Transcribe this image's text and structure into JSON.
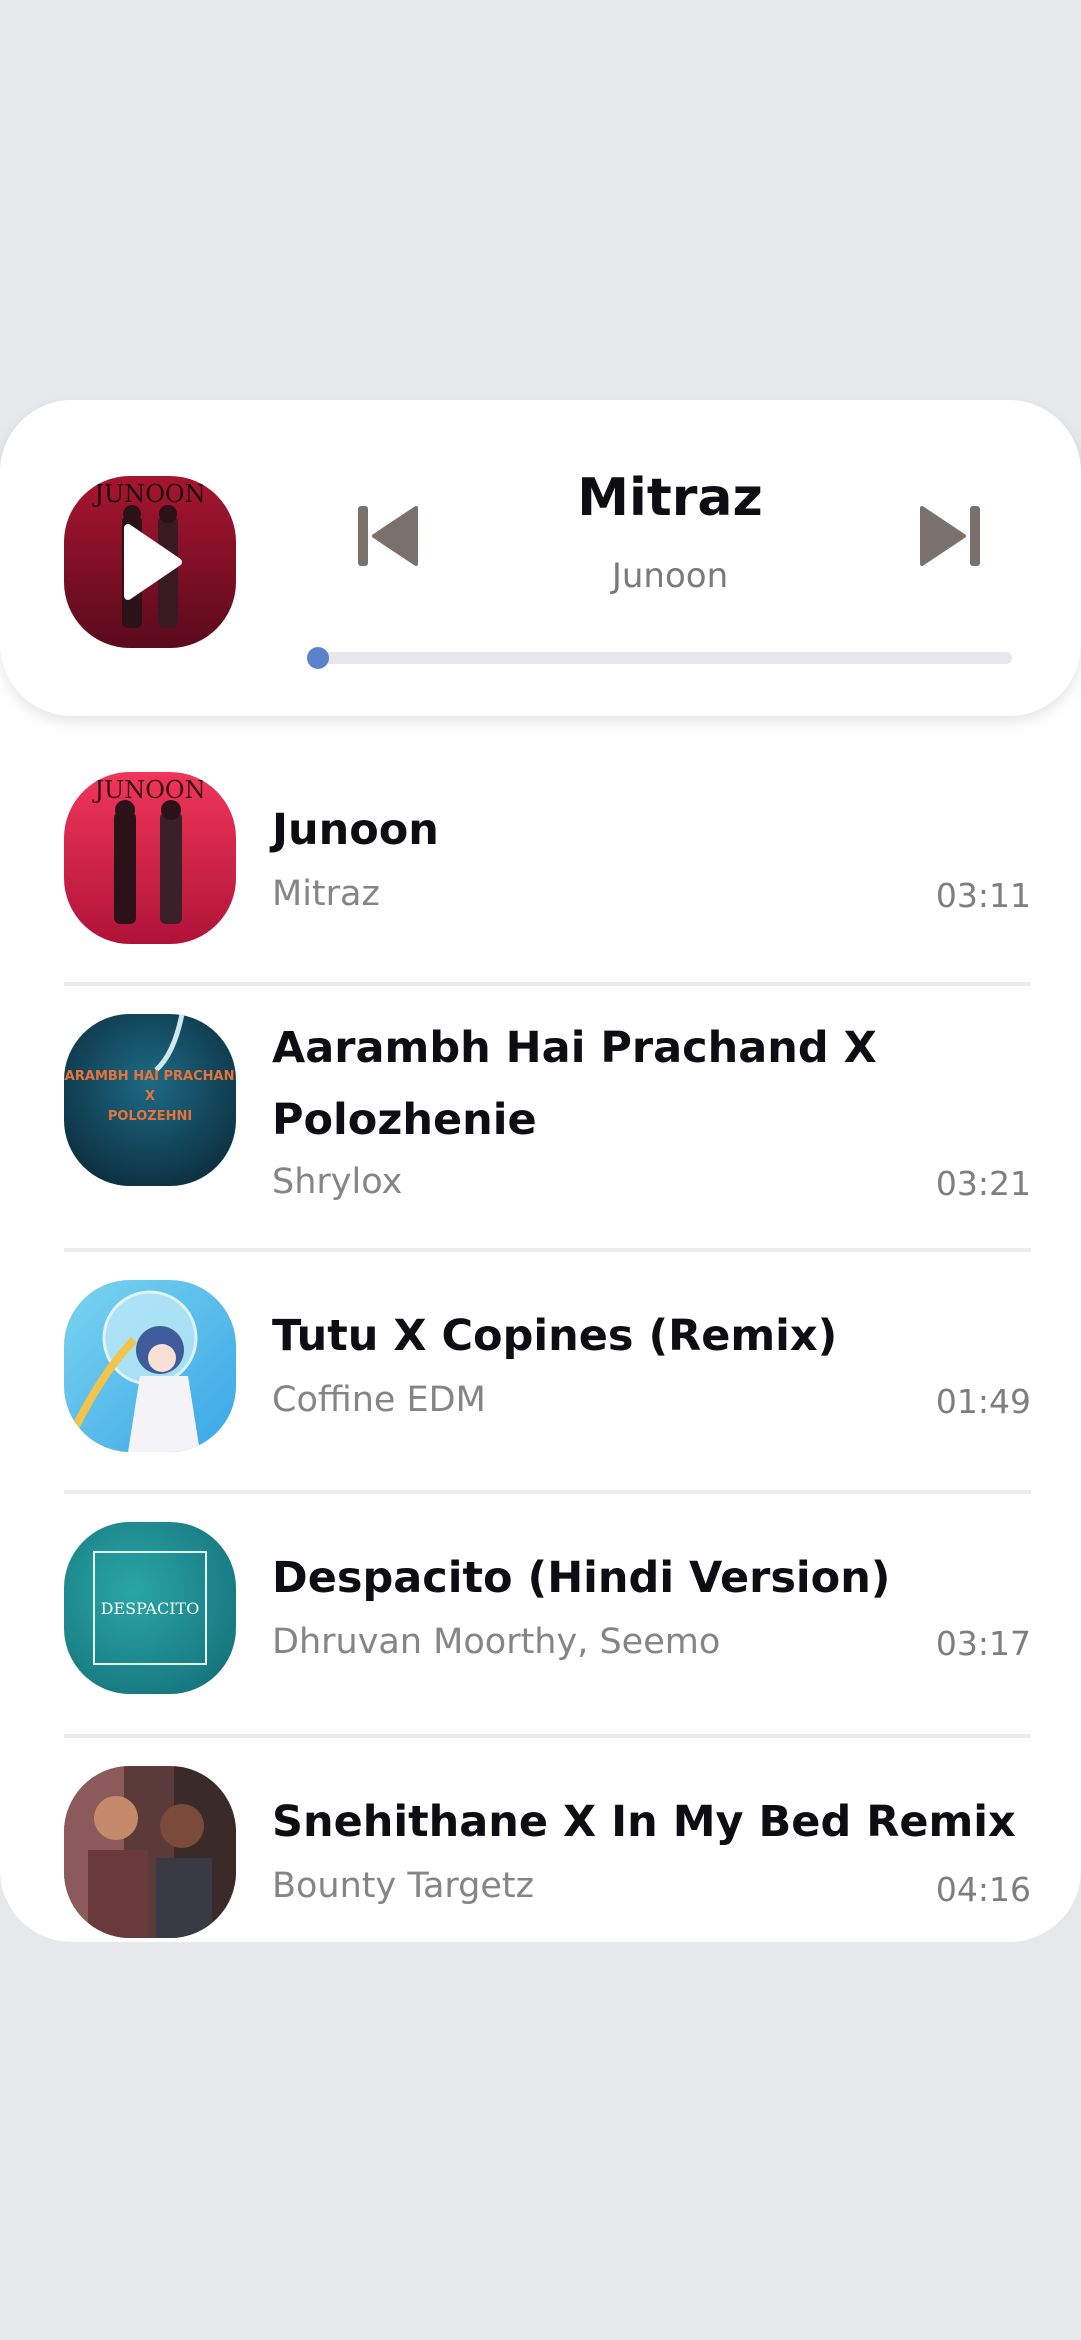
{
  "now_playing": {
    "title": "Mitraz",
    "artist": "Junoon",
    "cover_text": "JUNOON",
    "progress": 0.0
  },
  "controls": {
    "play_icon": "play-icon",
    "prev_icon": "skip-previous-icon",
    "next_icon": "skip-next-icon"
  },
  "tracks": [
    {
      "title": "Junoon",
      "artist": "Mitraz",
      "duration": "03:11",
      "cover_text": "JUNOON"
    },
    {
      "title": "Aarambh Hai Prachand X Polozhenie",
      "artist": "Shrylox",
      "duration": "03:21",
      "cover_text": "AARAMBH HAI PRACHAND X POLOZEHNI"
    },
    {
      "title": "Tutu X Copines (Remix)",
      "artist": "Coffine EDM",
      "duration": "01:49"
    },
    {
      "title": "Despacito (Hindi Version)",
      "artist": "Dhruvan Moorthy, Seemo",
      "duration": "03:17",
      "cover_text": "DESPACITO"
    },
    {
      "title": "Snehithane X In My Bed Remix",
      "artist": "Bounty Targetz",
      "duration": "04:16"
    }
  ],
  "colors": {
    "accent": "#5a83c9",
    "background": "#e7e8ea",
    "card": "#ffffff",
    "title_text": "#0e0e12",
    "secondary_text": "#858585",
    "icon": "#7a716c"
  }
}
